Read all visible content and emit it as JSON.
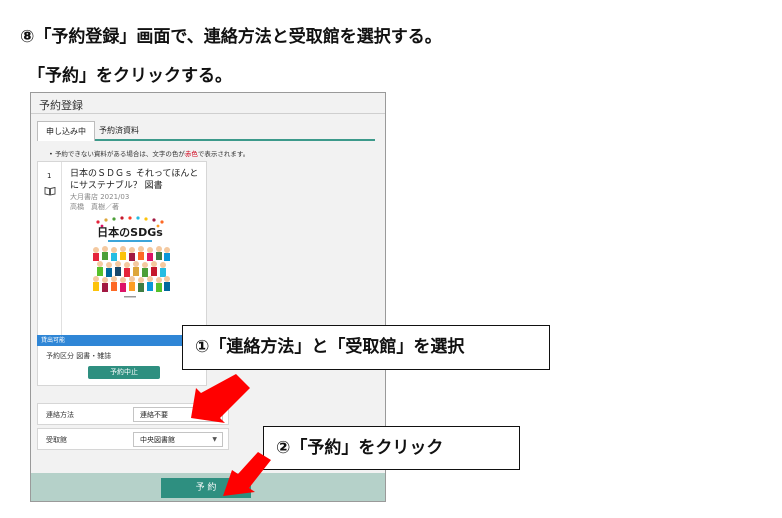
{
  "instructions": {
    "step": "⑧「予約登録」画面で、連絡方法と受取館を選択する。",
    "click": "「予約」をクリックする。"
  },
  "screen": {
    "title": "予約登録",
    "tabs": [
      {
        "label": "申し込み中",
        "active": true
      },
      {
        "label": "予約済資料",
        "active": false
      }
    ],
    "notice_prefix": "予約できない資料がある場合は、文字の色が",
    "notice_red": "赤色",
    "notice_suffix": "で表示されます。",
    "item": {
      "number": "1",
      "title": "日本のＳＤＧｓ それってほんとにサステナブル？ 図書",
      "publisher": "大月書店 2021/03",
      "author": "高橋　真樹／著",
      "cover_title": "日本のSDGs",
      "status": "貸出可能",
      "reservation_type": "予約区分 図書・雑誌",
      "cancel_label": "予約中止"
    },
    "contact": {
      "label": "連絡方法",
      "value": "連絡不要"
    },
    "pickup": {
      "label": "受取館",
      "value": "中央図書館"
    },
    "reserve_label": "予 約"
  },
  "callouts": {
    "first": "①「連絡方法」と「受取館」を選択",
    "second": "②「予約」をクリック"
  },
  "colors": {
    "accent": "#2e8f80",
    "status_blue": "#2f86d6",
    "footer": "#b5d1c9",
    "arrow": "#ff0000"
  }
}
